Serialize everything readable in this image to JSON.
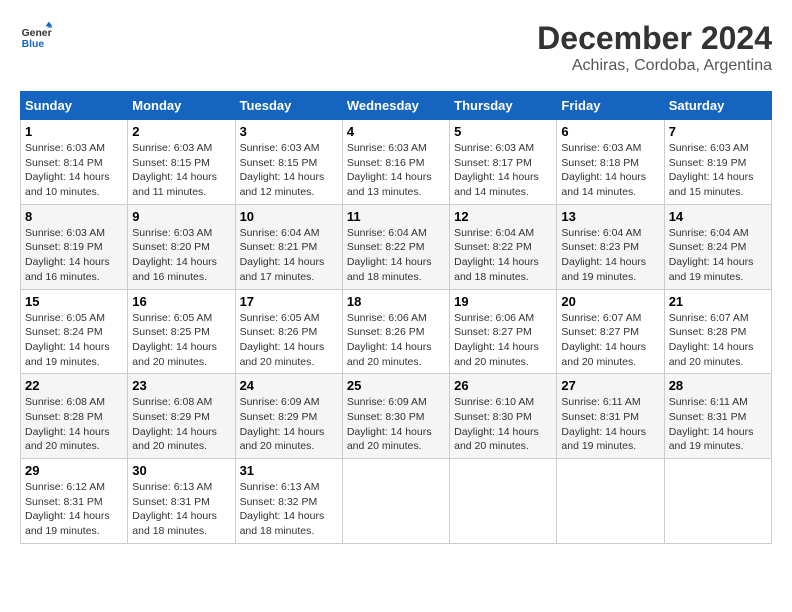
{
  "logo": {
    "text_general": "General",
    "text_blue": "Blue"
  },
  "title": "December 2024",
  "subtitle": "Achiras, Cordoba, Argentina",
  "days_of_week": [
    "Sunday",
    "Monday",
    "Tuesday",
    "Wednesday",
    "Thursday",
    "Friday",
    "Saturday"
  ],
  "weeks": [
    [
      {
        "day": "1",
        "sunrise": "6:03 AM",
        "sunset": "8:14 PM",
        "daylight": "14 hours and 10 minutes."
      },
      {
        "day": "2",
        "sunrise": "6:03 AM",
        "sunset": "8:15 PM",
        "daylight": "14 hours and 11 minutes."
      },
      {
        "day": "3",
        "sunrise": "6:03 AM",
        "sunset": "8:15 PM",
        "daylight": "14 hours and 12 minutes."
      },
      {
        "day": "4",
        "sunrise": "6:03 AM",
        "sunset": "8:16 PM",
        "daylight": "14 hours and 13 minutes."
      },
      {
        "day": "5",
        "sunrise": "6:03 AM",
        "sunset": "8:17 PM",
        "daylight": "14 hours and 14 minutes."
      },
      {
        "day": "6",
        "sunrise": "6:03 AM",
        "sunset": "8:18 PM",
        "daylight": "14 hours and 14 minutes."
      },
      {
        "day": "7",
        "sunrise": "6:03 AM",
        "sunset": "8:19 PM",
        "daylight": "14 hours and 15 minutes."
      }
    ],
    [
      {
        "day": "8",
        "sunrise": "6:03 AM",
        "sunset": "8:19 PM",
        "daylight": "14 hours and 16 minutes."
      },
      {
        "day": "9",
        "sunrise": "6:03 AM",
        "sunset": "8:20 PM",
        "daylight": "14 hours and 16 minutes."
      },
      {
        "day": "10",
        "sunrise": "6:04 AM",
        "sunset": "8:21 PM",
        "daylight": "14 hours and 17 minutes."
      },
      {
        "day": "11",
        "sunrise": "6:04 AM",
        "sunset": "8:22 PM",
        "daylight": "14 hours and 18 minutes."
      },
      {
        "day": "12",
        "sunrise": "6:04 AM",
        "sunset": "8:22 PM",
        "daylight": "14 hours and 18 minutes."
      },
      {
        "day": "13",
        "sunrise": "6:04 AM",
        "sunset": "8:23 PM",
        "daylight": "14 hours and 19 minutes."
      },
      {
        "day": "14",
        "sunrise": "6:04 AM",
        "sunset": "8:24 PM",
        "daylight": "14 hours and 19 minutes."
      }
    ],
    [
      {
        "day": "15",
        "sunrise": "6:05 AM",
        "sunset": "8:24 PM",
        "daylight": "14 hours and 19 minutes."
      },
      {
        "day": "16",
        "sunrise": "6:05 AM",
        "sunset": "8:25 PM",
        "daylight": "14 hours and 20 minutes."
      },
      {
        "day": "17",
        "sunrise": "6:05 AM",
        "sunset": "8:26 PM",
        "daylight": "14 hours and 20 minutes."
      },
      {
        "day": "18",
        "sunrise": "6:06 AM",
        "sunset": "8:26 PM",
        "daylight": "14 hours and 20 minutes."
      },
      {
        "day": "19",
        "sunrise": "6:06 AM",
        "sunset": "8:27 PM",
        "daylight": "14 hours and 20 minutes."
      },
      {
        "day": "20",
        "sunrise": "6:07 AM",
        "sunset": "8:27 PM",
        "daylight": "14 hours and 20 minutes."
      },
      {
        "day": "21",
        "sunrise": "6:07 AM",
        "sunset": "8:28 PM",
        "daylight": "14 hours and 20 minutes."
      }
    ],
    [
      {
        "day": "22",
        "sunrise": "6:08 AM",
        "sunset": "8:28 PM",
        "daylight": "14 hours and 20 minutes."
      },
      {
        "day": "23",
        "sunrise": "6:08 AM",
        "sunset": "8:29 PM",
        "daylight": "14 hours and 20 minutes."
      },
      {
        "day": "24",
        "sunrise": "6:09 AM",
        "sunset": "8:29 PM",
        "daylight": "14 hours and 20 minutes."
      },
      {
        "day": "25",
        "sunrise": "6:09 AM",
        "sunset": "8:30 PM",
        "daylight": "14 hours and 20 minutes."
      },
      {
        "day": "26",
        "sunrise": "6:10 AM",
        "sunset": "8:30 PM",
        "daylight": "14 hours and 20 minutes."
      },
      {
        "day": "27",
        "sunrise": "6:11 AM",
        "sunset": "8:31 PM",
        "daylight": "14 hours and 19 minutes."
      },
      {
        "day": "28",
        "sunrise": "6:11 AM",
        "sunset": "8:31 PM",
        "daylight": "14 hours and 19 minutes."
      }
    ],
    [
      {
        "day": "29",
        "sunrise": "6:12 AM",
        "sunset": "8:31 PM",
        "daylight": "14 hours and 19 minutes."
      },
      {
        "day": "30",
        "sunrise": "6:13 AM",
        "sunset": "8:31 PM",
        "daylight": "14 hours and 18 minutes."
      },
      {
        "day": "31",
        "sunrise": "6:13 AM",
        "sunset": "8:32 PM",
        "daylight": "14 hours and 18 minutes."
      },
      null,
      null,
      null,
      null
    ]
  ],
  "labels": {
    "sunrise": "Sunrise:",
    "sunset": "Sunset:",
    "daylight": "Daylight:"
  }
}
